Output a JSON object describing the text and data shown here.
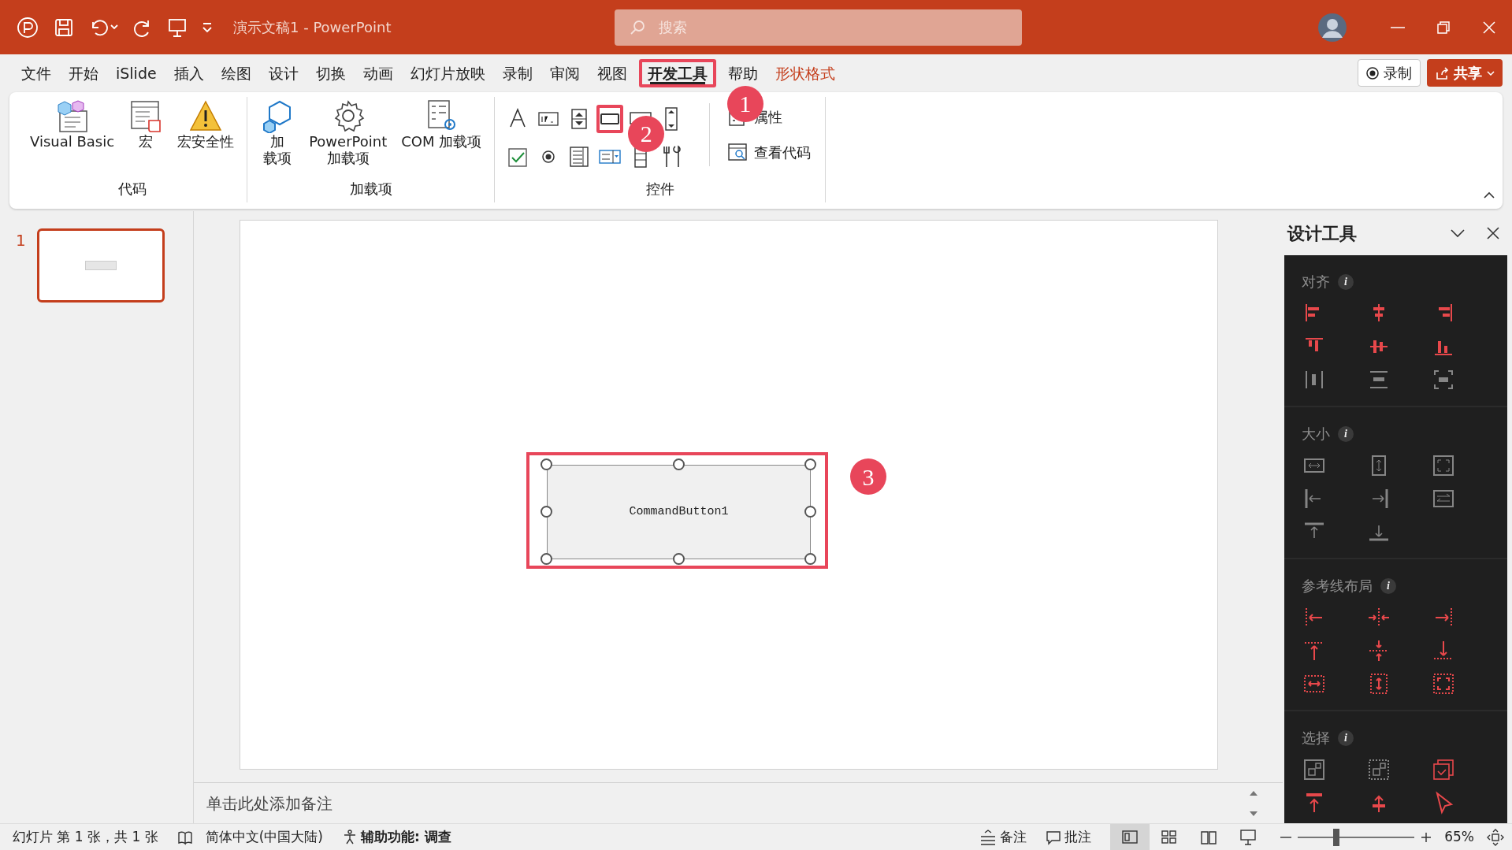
{
  "title_bar": {
    "title": "演示文稿1 - PowerPoint",
    "search": {
      "placeholder": "搜索"
    }
  },
  "menu_tabs": [
    {
      "label": "文件",
      "selected": false,
      "kind": "normal"
    },
    {
      "label": "开始",
      "selected": false,
      "kind": "normal"
    },
    {
      "label": "iSlide",
      "selected": false,
      "kind": "normal"
    },
    {
      "label": "插入",
      "selected": false,
      "kind": "normal"
    },
    {
      "label": "绘图",
      "selected": false,
      "kind": "normal"
    },
    {
      "label": "设计",
      "selected": false,
      "kind": "normal"
    },
    {
      "label": "切换",
      "selected": false,
      "kind": "normal"
    },
    {
      "label": "动画",
      "selected": false,
      "kind": "normal"
    },
    {
      "label": "幻灯片放映",
      "selected": false,
      "kind": "normal"
    },
    {
      "label": "录制",
      "selected": false,
      "kind": "normal"
    },
    {
      "label": "审阅",
      "selected": false,
      "kind": "normal"
    },
    {
      "label": "视图",
      "selected": false,
      "kind": "normal"
    },
    {
      "label": "开发工具",
      "selected": true,
      "kind": "normal",
      "annotation": "1"
    },
    {
      "label": "帮助",
      "selected": false,
      "kind": "normal"
    },
    {
      "label": "形状格式",
      "selected": false,
      "kind": "contextual"
    }
  ],
  "record_button": "录制",
  "share_button": "共享",
  "ribbon_groups": [
    {
      "label": "代码",
      "items": [
        {
          "kind": "vba",
          "lines": [
            "Visual Basic"
          ]
        },
        {
          "kind": "macro",
          "lines": [
            "宏"
          ]
        },
        {
          "kind": "warning",
          "lines": [
            "宏安全性"
          ]
        }
      ]
    },
    {
      "label": "加载项",
      "items": [
        {
          "kind": "addin",
          "lines": [
            "加",
            "载项"
          ]
        },
        {
          "kind": "gear",
          "lines": [
            "PowerPoint",
            "加载项"
          ]
        },
        {
          "kind": "com",
          "lines": [
            "COM 加载项"
          ]
        }
      ]
    },
    {
      "label": "控件",
      "controls": [
        {
          "kind": "label"
        },
        {
          "kind": "textbox"
        },
        {
          "kind": "spin"
        },
        {
          "kind": "button",
          "annotation": "2"
        },
        {
          "kind": "toggle"
        },
        {
          "kind": "scrollbar"
        },
        {
          "kind": "checkbox"
        },
        {
          "kind": "radio"
        },
        {
          "kind": "listbox"
        },
        {
          "kind": "combo"
        },
        {
          "kind": "frame"
        },
        {
          "kind": "tools"
        }
      ],
      "items": [
        {
          "kind": "properties",
          "label": "属性"
        },
        {
          "kind": "code",
          "label": "查看代码"
        }
      ]
    }
  ],
  "slide_thumbnails": [
    {
      "number": "1",
      "selected": true
    }
  ],
  "slide": {
    "command_button": {
      "caption": "CommandButton1",
      "selected": true,
      "annotation": "3"
    }
  },
  "notes_placeholder": "单击此处添加备注",
  "design_panel": {
    "title": "设计工具",
    "sections": [
      {
        "title": "对齐",
        "info": "i",
        "buttons": [
          {
            "kind": "align-left",
            "disabled": false
          },
          {
            "kind": "align-center",
            "disabled": false
          },
          {
            "kind": "align-right",
            "disabled": false
          },
          {
            "kind": "align-top",
            "disabled": false
          },
          {
            "kind": "align-middle",
            "disabled": false
          },
          {
            "kind": "align-bottom",
            "disabled": false
          },
          {
            "kind": "distribute-horizontal",
            "disabled": true
          },
          {
            "kind": "distribute-vertical",
            "disabled": true
          },
          {
            "kind": "fit-frame",
            "disabled": true
          }
        ]
      },
      {
        "title": "大小",
        "info": "i",
        "buttons": [
          {
            "kind": "same-width",
            "disabled": true
          },
          {
            "kind": "same-height",
            "disabled": true
          },
          {
            "kind": "same-size",
            "disabled": true
          },
          {
            "kind": "extend-left",
            "disabled": true
          },
          {
            "kind": "extend-right",
            "disabled": true
          },
          {
            "kind": "swap",
            "disabled": true
          },
          {
            "kind": "extend-top",
            "disabled": true
          },
          {
            "kind": "extend-bottom",
            "disabled": true
          }
        ]
      },
      {
        "title": "参考线布局",
        "info": "i",
        "buttons": [
          {
            "kind": "guide-left",
            "disabled": false
          },
          {
            "kind": "guide-center-horizontal",
            "disabled": false
          },
          {
            "kind": "guide-right",
            "disabled": false
          },
          {
            "kind": "guide-top",
            "disabled": false
          },
          {
            "kind": "guide-center-vertical",
            "disabled": false
          },
          {
            "kind": "guide-bottom",
            "disabled": false
          },
          {
            "kind": "guide-fit-width",
            "disabled": false
          },
          {
            "kind": "guide-fit-height",
            "disabled": false
          },
          {
            "kind": "guide-fit-both",
            "disabled": false
          }
        ]
      },
      {
        "title": "选择",
        "info": "i",
        "buttons": [
          {
            "kind": "select-similar",
            "disabled": true
          },
          {
            "kind": "select-dotted",
            "disabled": true
          },
          {
            "kind": "select-check",
            "disabled": false
          },
          {
            "kind": "bring-top",
            "disabled": false
          },
          {
            "kind": "move-up",
            "disabled": false
          },
          {
            "kind": "pointer",
            "disabled": false
          }
        ]
      }
    ]
  },
  "status_bar": {
    "slide_info": "幻灯片 第 1 张，共 1 张",
    "language": "简体中文(中国大陆)",
    "accessibility": "辅助功能: 调查",
    "notes": "备注",
    "comments": "批注",
    "views": [
      {
        "kind": "normal",
        "selected": true
      },
      {
        "kind": "sorter",
        "selected": false
      },
      {
        "kind": "reading",
        "selected": false
      },
      {
        "kind": "show",
        "selected": false
      }
    ],
    "zoom": {
      "level": 0.33,
      "percent": "65%"
    }
  }
}
